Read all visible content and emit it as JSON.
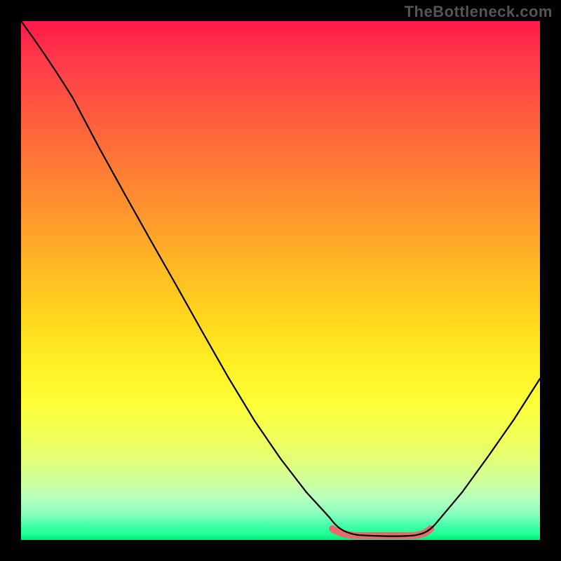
{
  "watermark": "TheBottleneck.com",
  "chart_data": {
    "type": "line",
    "title": "",
    "xlabel": "",
    "ylabel": "",
    "xlim": [
      0,
      100
    ],
    "ylim": [
      0,
      100
    ],
    "series": [
      {
        "name": "curve",
        "x": [
          0,
          5,
          10,
          15,
          20,
          25,
          30,
          35,
          40,
          45,
          50,
          55,
          60,
          62,
          65,
          70,
          75,
          78,
          80,
          85,
          90,
          95,
          100
        ],
        "y": [
          100,
          94,
          88,
          80,
          71,
          62,
          53,
          44,
          35,
          26,
          18,
          10,
          4,
          2,
          1,
          0.8,
          0.8,
          1,
          2,
          7,
          14,
          23,
          32
        ]
      }
    ],
    "highlight_range_x": [
      60,
      79
    ],
    "background_gradient": {
      "top": "#ff1a4a",
      "mid": "#ffe030",
      "bottom": "#00e87a"
    }
  }
}
